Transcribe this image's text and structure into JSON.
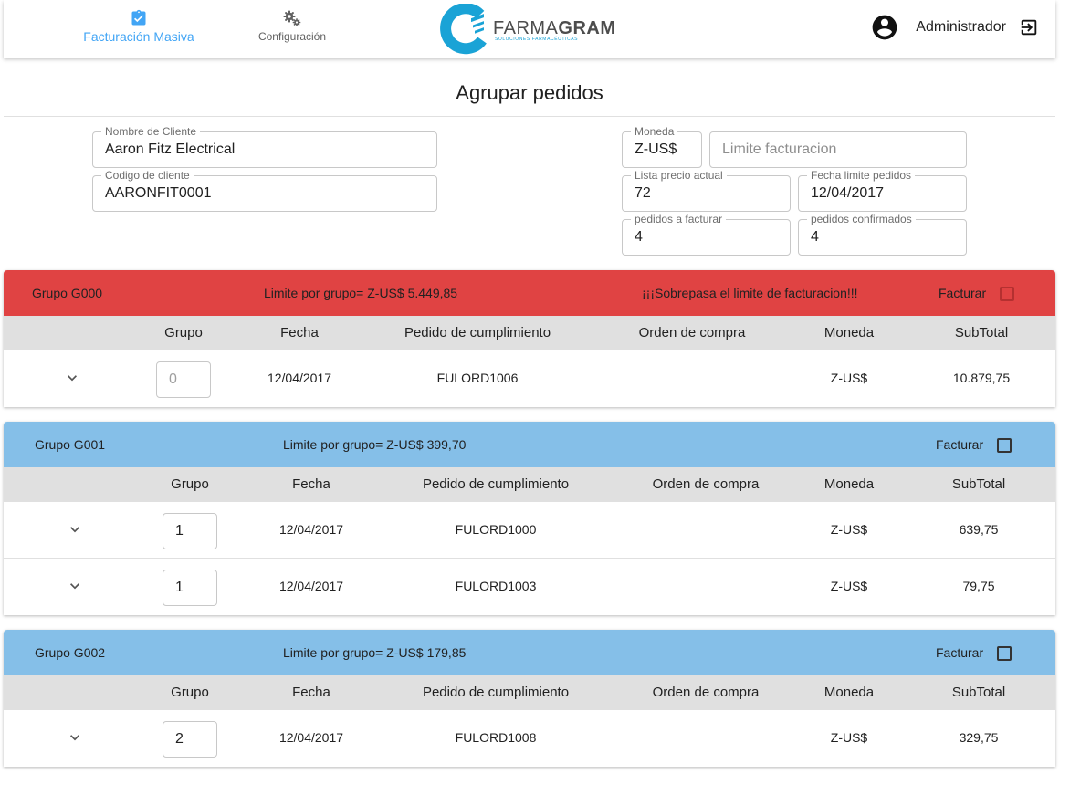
{
  "nav": {
    "billing_label": "Facturación Masiva",
    "config_label": "Configuración"
  },
  "logo": {
    "word_light": "FARMA",
    "word_bold": "GRAM",
    "tagline": "SOLUCIONES FARMACÉUTICAS"
  },
  "user": {
    "name": "Administrador"
  },
  "page": {
    "title": "Agrupar pedidos"
  },
  "form": {
    "client_name": {
      "label": "Nombre de Cliente",
      "value": "Aaron Fitz Electrical"
    },
    "client_code": {
      "label": "Codigo de cliente",
      "value": "AARONFIT0001"
    },
    "currency": {
      "label": "Moneda",
      "value": "Z-US$"
    },
    "billing_limit": {
      "placeholder": "Limite facturacion"
    },
    "price_list": {
      "label": "Lista precio actual",
      "value": "72"
    },
    "order_deadline": {
      "label": "Fecha limite pedidos",
      "value": "12/04/2017"
    },
    "orders_to_bill": {
      "label": "pedidos a facturar",
      "value": "4"
    },
    "orders_confirmed": {
      "label": "pedidos confirmados",
      "value": "4"
    }
  },
  "columns": {
    "group": "Grupo",
    "date": "Fecha",
    "fulfillment": "Pedido de cumplimiento",
    "purchase_order": "Orden de compra",
    "currency": "Moneda",
    "subtotal": "SubTotal"
  },
  "groups": [
    {
      "name": "Grupo G000",
      "limit": "Limite por grupo= Z-US$ 5.449,85",
      "warning": "¡¡¡Sobrepasa el limite de facturacion!!!",
      "bill_label": "Facturar",
      "status_color": "#e04343",
      "rows": [
        {
          "group": "0",
          "date": "12/04/2017",
          "fulfillment": "FULORD1006",
          "purchase_order": "",
          "currency": "Z-US$",
          "subtotal": "10.879,75"
        }
      ]
    },
    {
      "name": "Grupo G001",
      "limit": "Limite por grupo= Z-US$ 399,70",
      "bill_label": "Facturar",
      "status_color": "#85bfe8",
      "rows": [
        {
          "group": "1",
          "date": "12/04/2017",
          "fulfillment": "FULORD1000",
          "purchase_order": "",
          "currency": "Z-US$",
          "subtotal": "639,75"
        },
        {
          "group": "1",
          "date": "12/04/2017",
          "fulfillment": "FULORD1003",
          "purchase_order": "",
          "currency": "Z-US$",
          "subtotal": "79,75"
        }
      ]
    },
    {
      "name": "Grupo G002",
      "limit": "Limite por grupo= Z-US$ 179,85",
      "bill_label": "Facturar",
      "status_color": "#85bfe8",
      "rows": [
        {
          "group": "2",
          "date": "12/04/2017",
          "fulfillment": "FULORD1008",
          "purchase_order": "",
          "currency": "Z-US$",
          "subtotal": "329,75"
        }
      ]
    }
  ],
  "colors": {
    "accent": "#42a5f5",
    "over_limit": "#e04343",
    "within_limit": "#85bfe8",
    "table_header": "#e0e0e0"
  },
  "icons": {
    "billing": "clipboard-check-icon",
    "config": "gears-icon",
    "user": "account-circle-icon",
    "logout": "exit-icon",
    "expand": "chevron-down-icon"
  }
}
